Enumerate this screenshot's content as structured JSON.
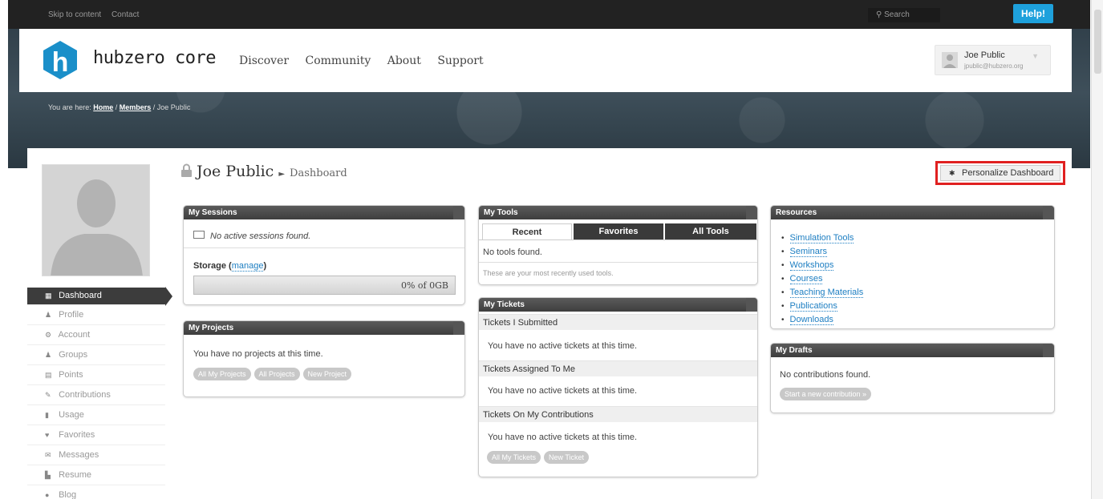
{
  "topbar": {
    "skip_link": "Skip to content",
    "contact_link": "Contact",
    "search_placeholder": "Search",
    "help_label": "Help!"
  },
  "brand": {
    "logo_letter": "h",
    "name": "hubzero core"
  },
  "nav": {
    "items": [
      "Discover",
      "Community",
      "About",
      "Support"
    ]
  },
  "user": {
    "name": "Joe Public",
    "email": "jpublic@hubzero.org"
  },
  "breadcrumb": {
    "prefix": "You are here:",
    "home": "Home",
    "members": "Members",
    "current": "Joe Public",
    "sep": " / "
  },
  "page": {
    "title": "Joe Public",
    "subtitle": "Dashboard",
    "personalize_label": "Personalize Dashboard"
  },
  "sidebar": {
    "items": [
      {
        "label": "Dashboard",
        "icon": "dashboard-icon",
        "glyph": "▦",
        "active": true
      },
      {
        "label": "Profile",
        "icon": "profile-icon",
        "glyph": "♟"
      },
      {
        "label": "Account",
        "icon": "account-icon",
        "glyph": "⚙"
      },
      {
        "label": "Groups",
        "icon": "groups-icon",
        "glyph": "♟"
      },
      {
        "label": "Points",
        "icon": "points-icon",
        "glyph": "▤"
      },
      {
        "label": "Contributions",
        "icon": "contributions-icon",
        "glyph": "✎"
      },
      {
        "label": "Usage",
        "icon": "usage-icon",
        "glyph": "▮"
      },
      {
        "label": "Favorites",
        "icon": "favorites-icon",
        "glyph": "♥"
      },
      {
        "label": "Messages",
        "icon": "messages-icon",
        "glyph": "✉"
      },
      {
        "label": "Resume",
        "icon": "resume-icon",
        "glyph": "▙"
      },
      {
        "label": "Blog",
        "icon": "blog-icon",
        "glyph": "●"
      }
    ]
  },
  "sessions": {
    "title": "My Sessions",
    "empty": "No active sessions found.",
    "storage_label": "Storage",
    "storage_link": "manage",
    "storage_value": "0% of 0GB",
    "storage_percent": 0
  },
  "projects": {
    "title": "My Projects",
    "empty": "You have no projects at this time.",
    "buttons": [
      "All My Projects",
      "All Projects",
      "New Project"
    ]
  },
  "tools": {
    "title": "My Tools",
    "tabs": [
      "Recent",
      "Favorites",
      "All Tools"
    ],
    "empty": "No tools found.",
    "note": "These are your most recently used tools."
  },
  "tickets": {
    "title": "My Tickets",
    "sections": [
      {
        "heading": "Tickets I Submitted",
        "message": "You have no active tickets at this time."
      },
      {
        "heading": "Tickets Assigned To Me",
        "message": "You have no active tickets at this time."
      },
      {
        "heading": "Tickets On My Contributions",
        "message": "You have no active tickets at this time."
      }
    ],
    "buttons": [
      "All My Tickets",
      "New Ticket"
    ]
  },
  "resources": {
    "title": "Resources",
    "links": [
      "Simulation Tools",
      "Seminars",
      "Workshops",
      "Courses",
      "Teaching Materials",
      "Publications",
      "Downloads"
    ]
  },
  "drafts": {
    "title": "My Drafts",
    "empty": "No contributions found.",
    "button": "Start a new contribution »"
  },
  "colors": {
    "accent": "#1ea1dc",
    "highlight": "#e02020",
    "module_header": "#444444"
  }
}
